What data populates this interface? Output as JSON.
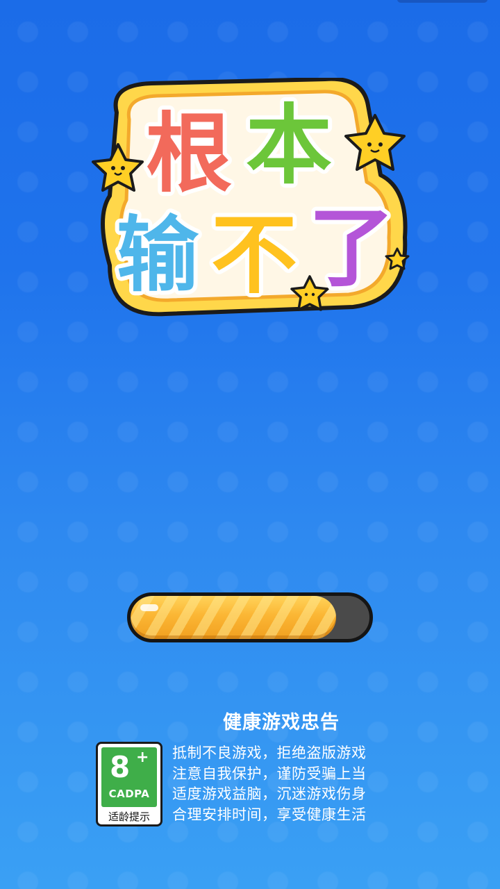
{
  "logo": {
    "line1": [
      "根",
      "本"
    ],
    "line2": [
      "输",
      "不",
      "了"
    ],
    "char_colors": [
      "#f26a5b",
      "#6cc63a",
      "#4fb6ea",
      "#ffc21f",
      "#b455d8"
    ]
  },
  "loading": {
    "progress": 0.86,
    "fill_color": "#fbb634",
    "track_color": "#4a4a4a"
  },
  "advisory": {
    "title": "健康游戏忠告",
    "lines": [
      "抵制不良游戏，拒绝盗版游戏",
      "注意自我保护，谨防受骗上当",
      "适度游戏益脑，沉迷游戏伤身",
      "合理安排时间，享受健康生活"
    ]
  },
  "age_rating": {
    "age": "8",
    "plus": "+",
    "org": "CADPA",
    "caption": "适龄提示",
    "color": "#3fae49"
  }
}
